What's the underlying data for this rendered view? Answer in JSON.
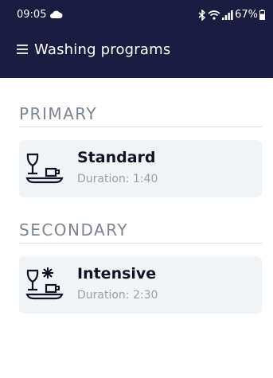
{
  "status_bar": {
    "time": "09:05",
    "battery": "67%",
    "icons": [
      "cloud-icon",
      "bluetooth-icon",
      "wifi-icon",
      "signal-icon",
      "battery-icon"
    ]
  },
  "app_bar": {
    "title": "Washing programs",
    "menu_icon": "menu-icon"
  },
  "sections": [
    {
      "title": "PRIMARY",
      "programs": [
        {
          "name": "Standard",
          "duration": "Duration: 1:40",
          "icon": "dishes-icon"
        }
      ]
    },
    {
      "title": "SECONDARY",
      "programs": [
        {
          "name": "Intensive",
          "duration": "Duration: 2:30",
          "icon": "dishes-intensive-icon"
        }
      ]
    }
  ],
  "colors": {
    "header_bg": "#1a1d3f",
    "section_title": "#7b8492",
    "card_bg": "#f1f3f6"
  }
}
